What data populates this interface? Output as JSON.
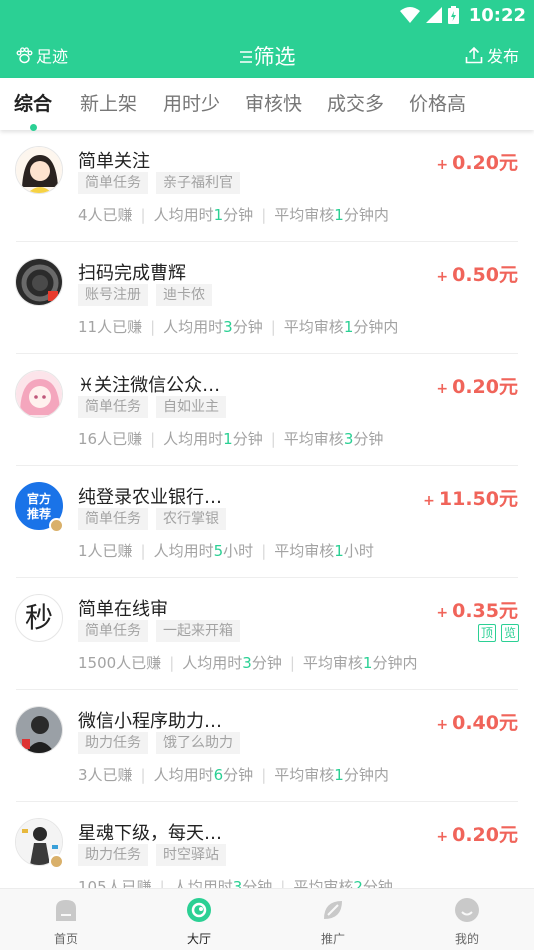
{
  "status": {
    "time": "10:22"
  },
  "header": {
    "footprint_label": "足迹",
    "filter_label": "筛选",
    "publish_label": "发布"
  },
  "tabs": [
    {
      "label": "综合",
      "active": true
    },
    {
      "label": "新上架"
    },
    {
      "label": "用时少"
    },
    {
      "label": "审核快"
    },
    {
      "label": "成交多"
    },
    {
      "label": "价格高"
    }
  ],
  "tasks": [
    {
      "title": "简单关注",
      "tags": [
        "简单任务",
        "亲子福利官"
      ],
      "earned": "4人已赚",
      "time_prefix": "人均用时",
      "time_num": "1",
      "time_unit": "分钟",
      "review_prefix": "平均审核",
      "review_num": "1",
      "review_unit": "分钟内",
      "price": "0.20元"
    },
    {
      "title": "扫码完成曹辉",
      "tags": [
        "账号注册",
        "迪卡侬"
      ],
      "earned": "11人已赚",
      "time_prefix": "人均用时",
      "time_num": "3",
      "time_unit": "分钟",
      "review_prefix": "平均审核",
      "review_num": "1",
      "review_unit": "分钟内",
      "price": "0.50元"
    },
    {
      "title": "♓关注微信公众…",
      "tags": [
        "简单任务",
        "自如业主"
      ],
      "earned": "16人已赚",
      "time_prefix": "人均用时",
      "time_num": "1",
      "time_unit": "分钟",
      "review_prefix": "平均审核",
      "review_num": "3",
      "review_unit": "分钟",
      "price": "0.20元"
    },
    {
      "title": "纯登录农业银行…",
      "tags": [
        "简单任务",
        "农行掌银"
      ],
      "earned": "1人已赚",
      "time_prefix": "人均用时",
      "time_num": "5",
      "time_unit": "小时",
      "review_prefix": "平均审核",
      "review_num": "1",
      "review_unit": "小时",
      "price": "11.50元",
      "avatar_text": [
        "官方",
        "推荐"
      ]
    },
    {
      "title": "简单在线审",
      "tags": [
        "简单任务",
        "一起来开箱"
      ],
      "earned": "1500人已赚",
      "time_prefix": "人均用时",
      "time_num": "3",
      "time_unit": "分钟",
      "review_prefix": "平均审核",
      "review_num": "1",
      "review_unit": "分钟内",
      "price": "0.35元",
      "flags": [
        "顶",
        "览"
      ],
      "avatar_text": [
        "秒"
      ]
    },
    {
      "title": "微信小程序助力…",
      "tags": [
        "助力任务",
        "饿了么助力"
      ],
      "earned": "3人已赚",
      "time_prefix": "人均用时",
      "time_num": "6",
      "time_unit": "分钟",
      "review_prefix": "平均审核",
      "review_num": "1",
      "review_unit": "分钟内",
      "price": "0.40元"
    },
    {
      "title": "星魂下级，每天…",
      "tags": [
        "助力任务",
        "时空驿站"
      ],
      "earned": "105人已赚",
      "time_prefix": "人均用时",
      "time_num": "3",
      "time_unit": "分钟",
      "review_prefix": "平均审核",
      "review_num": "2",
      "review_unit": "分钟",
      "price": "0.20元"
    }
  ],
  "price_plus": "+",
  "bottom_nav": [
    {
      "label": "首页",
      "icon": "home-icon"
    },
    {
      "label": "大厅",
      "icon": "hall-icon",
      "active": true
    },
    {
      "label": "推广",
      "icon": "promote-icon"
    },
    {
      "label": "我的",
      "icon": "profile-icon"
    }
  ],
  "colors": {
    "brand": "#2bd094",
    "price": "#f0645a"
  }
}
